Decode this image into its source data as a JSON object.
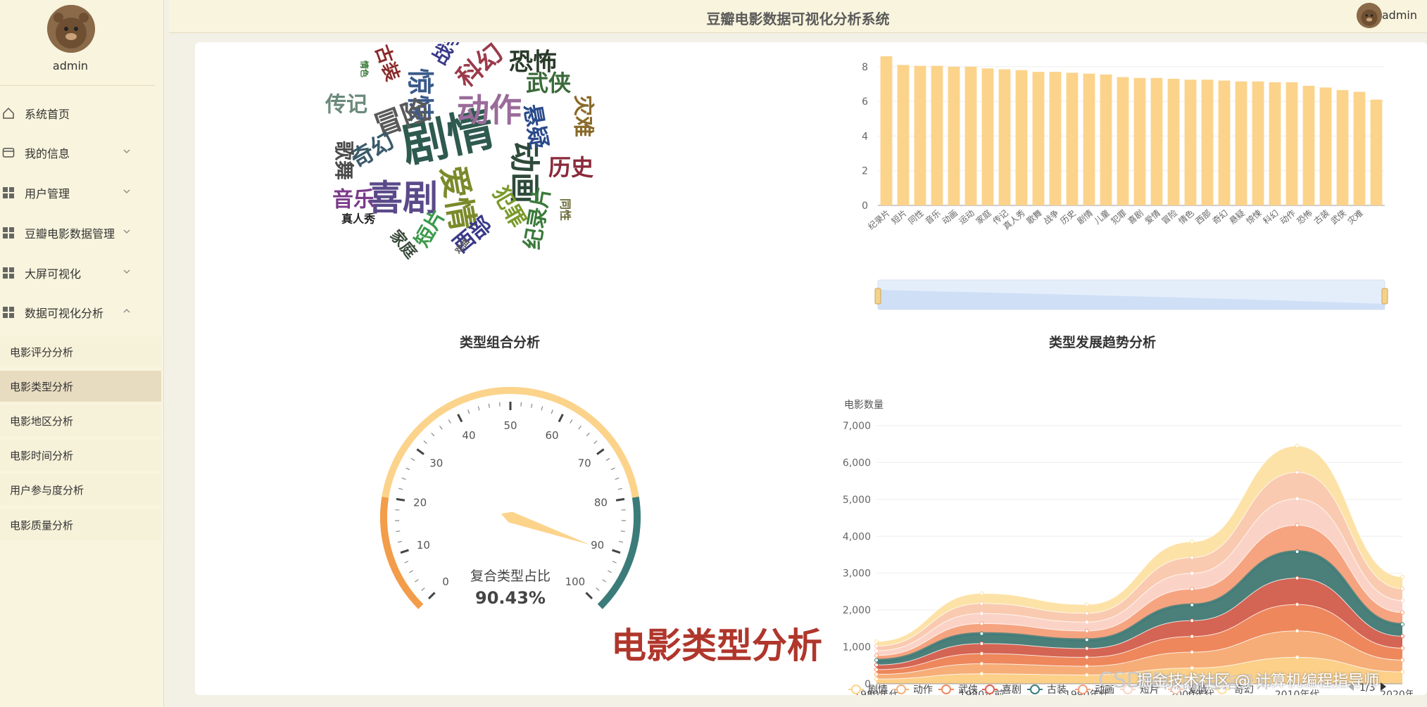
{
  "sidebar": {
    "username": "admin",
    "menu": [
      {
        "label": "系统首页",
        "icon": "home-icon"
      },
      {
        "label": "我的信息",
        "icon": "profile-icon"
      },
      {
        "label": "用户管理",
        "icon": "grid-icon"
      },
      {
        "label": "豆瓣电影数据管理",
        "icon": "grid-icon"
      },
      {
        "label": "大屏可视化",
        "icon": "grid-icon"
      },
      {
        "label": "数据可视化分析",
        "icon": "grid-icon"
      }
    ],
    "submenu": [
      {
        "label": "电影评分分析"
      },
      {
        "label": "电影类型分析"
      },
      {
        "label": "电影地区分析"
      },
      {
        "label": "电影时间分析"
      },
      {
        "label": "用户参与度分析"
      },
      {
        "label": "电影质量分析"
      }
    ]
  },
  "header": {
    "title": "豆瓣电影数据可视化分析系统",
    "username": "admin"
  },
  "overlay": {
    "caption": "电影类型分析",
    "watermark_left": "CSDN",
    "watermark_juejin": "掘金技术社区 @ 计算机编程指导师",
    "watermark_right": "计算机编程指导师"
  },
  "wordcloud": {
    "words": [
      {
        "text": "剧情",
        "color": "#2e5a4f"
      },
      {
        "text": "喜剧",
        "color": "#5b4a8a"
      },
      {
        "text": "动作",
        "color": "#9a6b9a"
      },
      {
        "text": "爱情",
        "color": "#7a8a2a"
      },
      {
        "text": "动画",
        "color": "#2e4a3a"
      },
      {
        "text": "惊悚",
        "color": "#3a5a8a"
      },
      {
        "text": "冒险",
        "color": "#5a5a5a"
      },
      {
        "text": "科幻",
        "color": "#9a3a4a"
      },
      {
        "text": "恐怖",
        "color": "#2a3a2a"
      },
      {
        "text": "武侠",
        "color": "#3a6a3a"
      },
      {
        "text": "悬疑",
        "color": "#2a4a8a"
      },
      {
        "text": "灾难",
        "color": "#8a6a2a"
      },
      {
        "text": "历史",
        "color": "#8a2a3a"
      },
      {
        "text": "纪录片",
        "color": "#3a7a3a"
      },
      {
        "text": "犯罪",
        "color": "#7a9a2a"
      },
      {
        "text": "西部",
        "color": "#3a3a8a"
      },
      {
        "text": "短片",
        "color": "#3a9a4a"
      },
      {
        "text": "奇幻",
        "color": "#3a5a6a"
      },
      {
        "text": "传记",
        "color": "#6a8a7a"
      },
      {
        "text": "歌舞",
        "color": "#4a4a4a"
      },
      {
        "text": "音乐",
        "color": "#7a3a8a"
      },
      {
        "text": "家庭",
        "color": "#3a4a3a"
      },
      {
        "text": "真人秀",
        "color": "#222222"
      },
      {
        "text": "战争",
        "color": "#3a3a8a"
      },
      {
        "text": "古装",
        "color": "#8a2a2a"
      },
      {
        "text": "同性",
        "color": "#6a6a3a"
      },
      {
        "text": "戏曲",
        "color": "#5a5a5a"
      },
      {
        "text": "情色",
        "color": "#3a7a3a"
      }
    ]
  },
  "charts": {
    "gauge": {
      "title": "类型组合分析",
      "detail_label": "复合类型占比",
      "detail_value": "90.43%"
    },
    "stream": {
      "title": "类型发展趋势分析",
      "ylabel": "电影数量",
      "pager": "1/3"
    }
  },
  "chart_data": [
    {
      "type": "bar",
      "categories": [
        "纪录片",
        "短片",
        "同性",
        "音乐",
        "动画",
        "运动",
        "家庭",
        "传记",
        "真人秀",
        "歌舞",
        "战争",
        "历史",
        "剧情",
        "儿童",
        "犯罪",
        "喜剧",
        "爱情",
        "冒险",
        "情色",
        "西部",
        "奇幻",
        "悬疑",
        "惊悚",
        "科幻",
        "动作",
        "恐怖",
        "古装",
        "武侠",
        "灾难"
      ],
      "values": [
        8.6,
        8.1,
        8.05,
        8.05,
        8.0,
        8.0,
        7.9,
        7.85,
        7.8,
        7.7,
        7.7,
        7.65,
        7.6,
        7.55,
        7.4,
        7.35,
        7.35,
        7.3,
        7.25,
        7.25,
        7.2,
        7.15,
        7.15,
        7.1,
        7.1,
        6.9,
        6.8,
        6.65,
        6.55,
        6.1
      ],
      "ylim": [
        0,
        8
      ],
      "yticks": [
        0,
        2,
        4,
        6,
        8
      ],
      "color": "#fcd38b"
    },
    {
      "type": "gauge",
      "value": 90.43,
      "min": 0,
      "max": 100,
      "ticks": [
        0,
        10,
        20,
        30,
        40,
        50,
        60,
        70,
        80,
        90,
        100
      ],
      "colors": [
        "#f39c4a",
        "#fcd38b",
        "#3b7c7a"
      ]
    },
    {
      "type": "area",
      "categories": [
        "1980年代",
        "1980年前",
        "1990年代",
        "2000年代",
        "2010年代",
        "2020年代"
      ],
      "total": [
        1150,
        2450,
        2150,
        3850,
        6450,
        2900
      ],
      "ylim": [
        0,
        7000
      ],
      "yticks": [
        0,
        1000,
        2000,
        3000,
        4000,
        5000,
        6000,
        7000
      ],
      "series": [
        {
          "name": "剧情"
        },
        {
          "name": "动作"
        },
        {
          "name": "武侠"
        },
        {
          "name": "喜剧"
        },
        {
          "name": "古装"
        },
        {
          "name": "动画"
        },
        {
          "name": "短片"
        },
        {
          "name": "爱情"
        },
        {
          "name": "奇幻"
        }
      ],
      "series_colors": [
        "#fcd38b",
        "#f6b07a",
        "#f08a5d",
        "#e0624f",
        "#3b7c7a",
        "#f5a07a",
        "#fbd4c8",
        "#f8c8b0",
        "#fde0a0"
      ]
    }
  ]
}
